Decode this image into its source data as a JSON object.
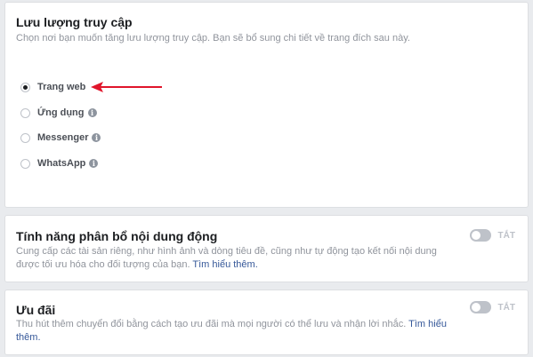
{
  "traffic": {
    "title": "Lưu lượng truy cập",
    "description": "Chọn nơi bạn muốn tăng lưu lượng truy cập. Bạn sẽ bổ sung chi tiết về trang đích sau này.",
    "options": [
      {
        "label": "Trang web",
        "selected": true
      },
      {
        "label": "Ứng dụng",
        "selected": false,
        "info_icon": "info-icon"
      },
      {
        "label": "Messenger",
        "selected": false,
        "info_icon": "info-icon"
      },
      {
        "label": "WhatsApp",
        "selected": false,
        "info_icon": "info-icon"
      }
    ],
    "annotation_color": "#e0152b"
  },
  "dynamic_content": {
    "title": "Tính năng phân bổ nội dung động",
    "description": "Cung cấp các tài sản riêng, như hình ảnh và dòng tiêu đề, cũng như tự động tạo kết nối nội dung được tối ưu hóa cho đối tượng của bạn.",
    "link": "Tìm hiểu thêm.",
    "toggle_label": "TẮT",
    "toggle_on": false
  },
  "offer": {
    "title": "Ưu đãi",
    "description": "Thu hút thêm chuyển đổi bằng cách tạo ưu đãi mà mọi người có thể lưu và nhận lời nhắc.",
    "link": "Tìm hiểu thêm.",
    "toggle_label": "TẮT",
    "toggle_on": false
  }
}
